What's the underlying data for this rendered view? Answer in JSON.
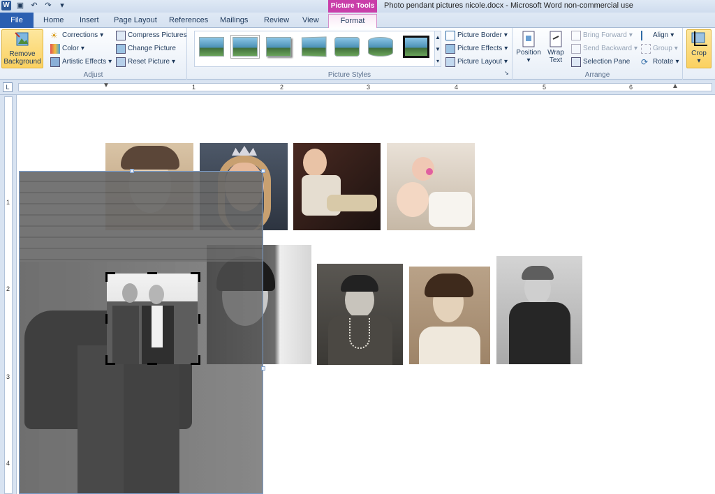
{
  "window": {
    "title": "Photo pendant pictures nicole.docx - Microsoft Word non-commercial use",
    "contextual_group": "Picture Tools"
  },
  "tabs": [
    "File",
    "Home",
    "Insert",
    "Page Layout",
    "References",
    "Mailings",
    "Review",
    "View",
    "Format"
  ],
  "ribbon": {
    "adjust": {
      "label": "Adjust",
      "remove_background": "Remove Background",
      "corrections": "Corrections",
      "color": "Color",
      "artistic_effects": "Artistic Effects",
      "compress_pictures": "Compress Pictures",
      "change_picture": "Change Picture",
      "reset_picture": "Reset Picture"
    },
    "picture_styles": {
      "label": "Picture Styles",
      "picture_border": "Picture Border",
      "picture_effects": "Picture Effects",
      "picture_layout": "Picture Layout",
      "selected_style_index": 6
    },
    "arrange": {
      "label": "Arrange",
      "position": "Position",
      "wrap_text": "Wrap Text",
      "bring_forward": "Bring Forward",
      "send_backward": "Send Backward",
      "selection_pane": "Selection Pane",
      "align": "Align",
      "group": "Group",
      "rotate": "Rotate"
    },
    "size": {
      "crop": "Crop"
    }
  },
  "ruler": {
    "top_numbers": [
      "1",
      "2",
      "3",
      "4",
      "5",
      "6"
    ],
    "left_numbers": [
      "1",
      "2",
      "3",
      "4"
    ]
  },
  "colors": {
    "file_tab": "#2b5fb1",
    "contextual_tab": "#c93ea9",
    "highlight_button": "#fbd160"
  }
}
